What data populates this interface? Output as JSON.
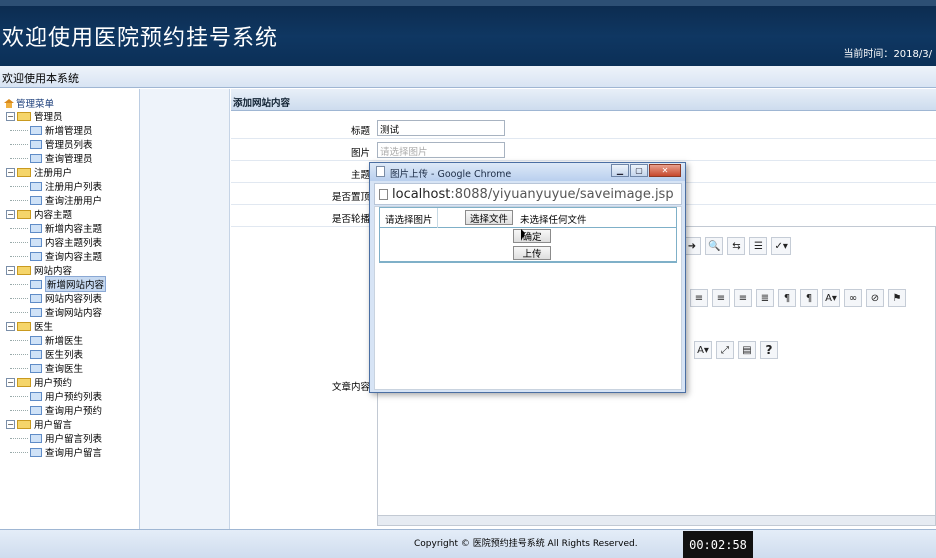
{
  "header": {
    "title": "欢迎使用医院预约挂号系统",
    "time_label": "当前时间：",
    "time_value": "2018/3/"
  },
  "welcome": "欢迎使用本系统",
  "sidebar": {
    "root": "管理菜单",
    "groups": [
      {
        "label": "管理员",
        "items": [
          "新增管理员",
          "管理员列表",
          "查询管理员"
        ]
      },
      {
        "label": "注册用户",
        "items": [
          "注册用户列表",
          "查询注册用户"
        ]
      },
      {
        "label": "内容主题",
        "items": [
          "新增内容主题",
          "内容主题列表",
          "查询内容主题"
        ]
      },
      {
        "label": "网站内容",
        "items": [
          "新增网站内容",
          "网站内容列表",
          "查询网站内容"
        ]
      },
      {
        "label": "医生",
        "items": [
          "新增医生",
          "医生列表",
          "查询医生"
        ]
      },
      {
        "label": "用户预约",
        "items": [
          "用户预约列表",
          "查询用户预约"
        ]
      },
      {
        "label": "用户留言",
        "items": [
          "用户留言列表",
          "查询用户留言"
        ]
      }
    ],
    "active_item": "新增网站内容"
  },
  "main": {
    "panel_title": "添加网站内容",
    "fields": {
      "title_label": "标题",
      "title_value": "测试",
      "image_label": "图片",
      "image_placeholder": "请选择图片",
      "topic_label": "主题",
      "pinned_label": "是否置顶",
      "carousel_label": "是否轮播",
      "content_label": "文章内容"
    }
  },
  "popup": {
    "title": "图片上传 - Google Chrome",
    "url_host": "localhost",
    "url_rest": ":8088/yiyuanyuyue/saveimage.jsp",
    "select_label": "请选择图片",
    "file_button": "选择文件",
    "no_file": "未选择任何文件",
    "ok_button": "确定",
    "upload_button": "上传"
  },
  "footer": {
    "copyright": "Copyright © 医院预约挂号系统 All Rights Reserved."
  },
  "timer": "00:02:58"
}
